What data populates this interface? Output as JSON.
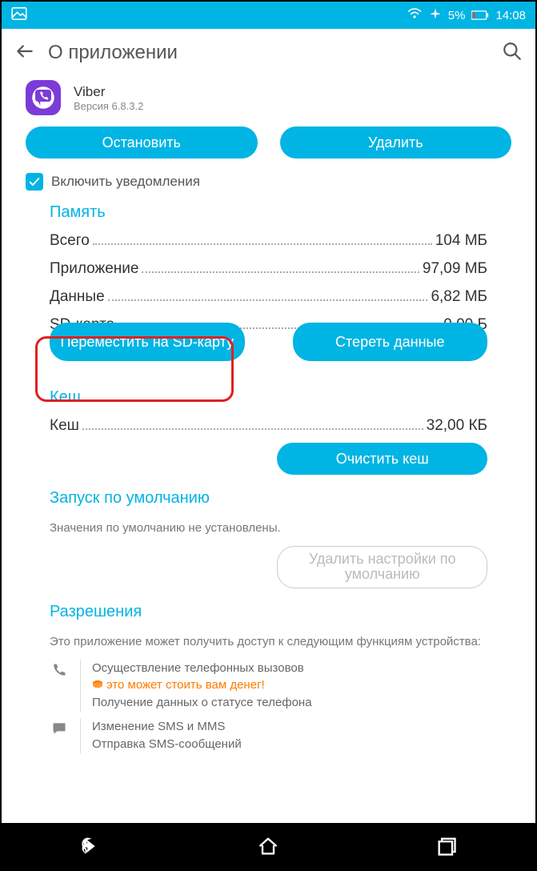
{
  "status": {
    "battery_pct": "5%",
    "time": "14:08"
  },
  "appbar": {
    "title": "О приложении"
  },
  "app": {
    "name": "Viber",
    "version": "Версия 6.8.3.2"
  },
  "actions": {
    "stop": "Остановить",
    "uninstall": "Удалить"
  },
  "notifications": {
    "label": "Включить уведомления",
    "checked": true
  },
  "memory": {
    "title": "Память",
    "rows": {
      "total_k": "Всего",
      "total_v": "104 МБ",
      "app_k": "Приложение",
      "app_v": "97,09 МБ",
      "data_k": "Данные",
      "data_v": "6,82 МБ",
      "sd_k": "SD-карта",
      "sd_v": "0,00 Б"
    },
    "move_sd": "Переместить на SD-карту",
    "clear_data": "Стереть данные"
  },
  "cache": {
    "title": "Кеш",
    "row_k": "Кеш",
    "row_v": "32,00 КБ",
    "clear": "Очистить кеш"
  },
  "launch": {
    "title": "Запуск по умолчанию",
    "caption": "Значения по умолчанию не установлены.",
    "clear_defaults": "Удалить настройки по умолчанию"
  },
  "perms": {
    "title": "Разрешения",
    "caption": "Это приложение может получить доступ к следующим функциям устройства:",
    "phone1": "Осуществление телефонных вызовов",
    "phone_warn": "это может стоить вам денег!",
    "phone2": "Получение данных о статусе телефона",
    "sms1": "Изменение SMS и MMS",
    "sms2": "Отправка SMS-сообщений"
  }
}
